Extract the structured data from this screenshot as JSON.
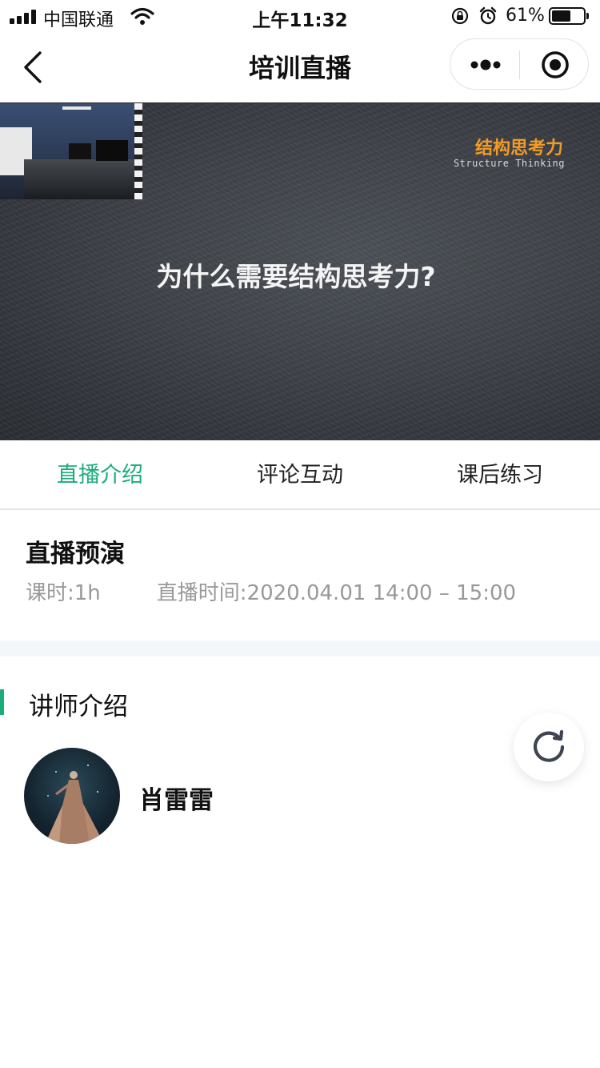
{
  "status_bar": {
    "carrier": "中国联通",
    "time": "上午11:32",
    "battery_percent": "61%",
    "battery_level": 0.61,
    "icons": [
      "signal-icon",
      "wifi-icon",
      "rotation-lock-icon",
      "alarm-icon",
      "battery-icon"
    ]
  },
  "nav": {
    "title": "培训直播",
    "icons": [
      "back-icon",
      "more-icon",
      "close-miniprogram-icon"
    ]
  },
  "video": {
    "brand_cn": "结构思考力",
    "brand_en": "Structure Thinking",
    "headline": "为什么需要结构思考力?"
  },
  "tabs": [
    {
      "label": "直播介绍",
      "active": true
    },
    {
      "label": "评论互动",
      "active": false
    },
    {
      "label": "课后练习",
      "active": false
    }
  ],
  "course": {
    "title": "直播预演",
    "duration": "课时:1h",
    "time": "直播时间:2020.04.01 14:00 – 15:00"
  },
  "teacher": {
    "heading": "讲师介绍",
    "name": "肖雷雷"
  },
  "colors": {
    "accent": "#1aad7a",
    "brand_orange": "#f39b24",
    "muted_text": "#999999"
  }
}
